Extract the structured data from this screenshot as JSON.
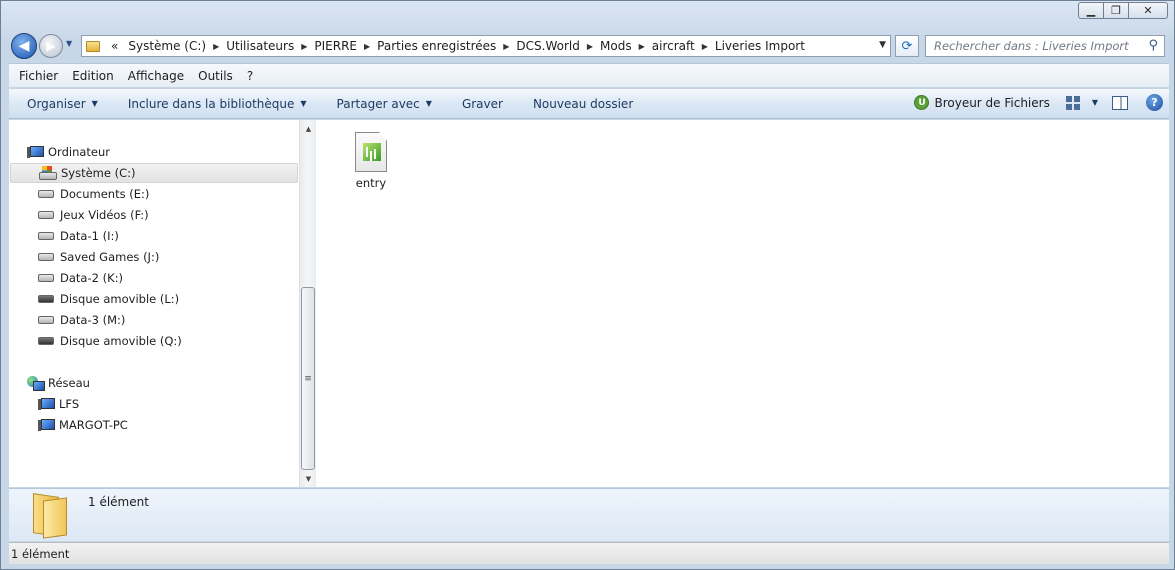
{
  "window": {
    "buttons": {
      "minimize": "▁",
      "maximize": "❐",
      "close": "✕"
    }
  },
  "nav": {
    "back_glyph": "◀",
    "forward_glyph": "▶",
    "history_glyph": "▼",
    "overflow": "«"
  },
  "address": {
    "crumbs": [
      "Système (C:)",
      "Utilisateurs",
      "PIERRE",
      "Parties enregistrées",
      "DCS.World",
      "Mods",
      "aircraft",
      "Liveries Import"
    ],
    "dropdown_glyph": "▼",
    "refresh_glyph": "⟳"
  },
  "search": {
    "placeholder": "Rechercher dans : Liveries Import",
    "icon_glyph": "⚲"
  },
  "menu": {
    "items": [
      "Fichier",
      "Edition",
      "Affichage",
      "Outils",
      "?"
    ]
  },
  "commands": {
    "organize": "Organiser",
    "include_library": "Inclure dans la bibliothèque",
    "share_with": "Partager avec",
    "burn": "Graver",
    "new_folder": "Nouveau dossier",
    "shredder": "Broyeur de Fichiers",
    "shredder_icon_letter": "U",
    "help": "?"
  },
  "tree": {
    "computer": "Ordinateur",
    "drives": [
      {
        "label": "Système (C:)",
        "type": "system",
        "selected": true
      },
      {
        "label": "Documents (E:)",
        "type": "fixed"
      },
      {
        "label": "Jeux Vidéos (F:)",
        "type": "fixed"
      },
      {
        "label": "Data-1 (I:)",
        "type": "fixed"
      },
      {
        "label": "Saved Games (J:)",
        "type": "fixed"
      },
      {
        "label": "Data-2 (K:)",
        "type": "fixed"
      },
      {
        "label": "Disque amovible (L:)",
        "type": "removable"
      },
      {
        "label": "Data-3 (M:)",
        "type": "fixed"
      },
      {
        "label": "Disque amovible (Q:)",
        "type": "removable"
      }
    ],
    "network": "Réseau",
    "hosts": [
      "LFS",
      "MARGOT-PC"
    ]
  },
  "scrollbar": {
    "up": "▲",
    "down": "▼",
    "grip": "≡"
  },
  "files": [
    {
      "name": "entry",
      "icon": "spreadsheet-file-icon"
    }
  ],
  "details": {
    "count": "1 élément"
  },
  "status": {
    "count": "1 élément"
  },
  "colors": {
    "accent": "#1a55b0",
    "command_text": "#1e3b63"
  }
}
